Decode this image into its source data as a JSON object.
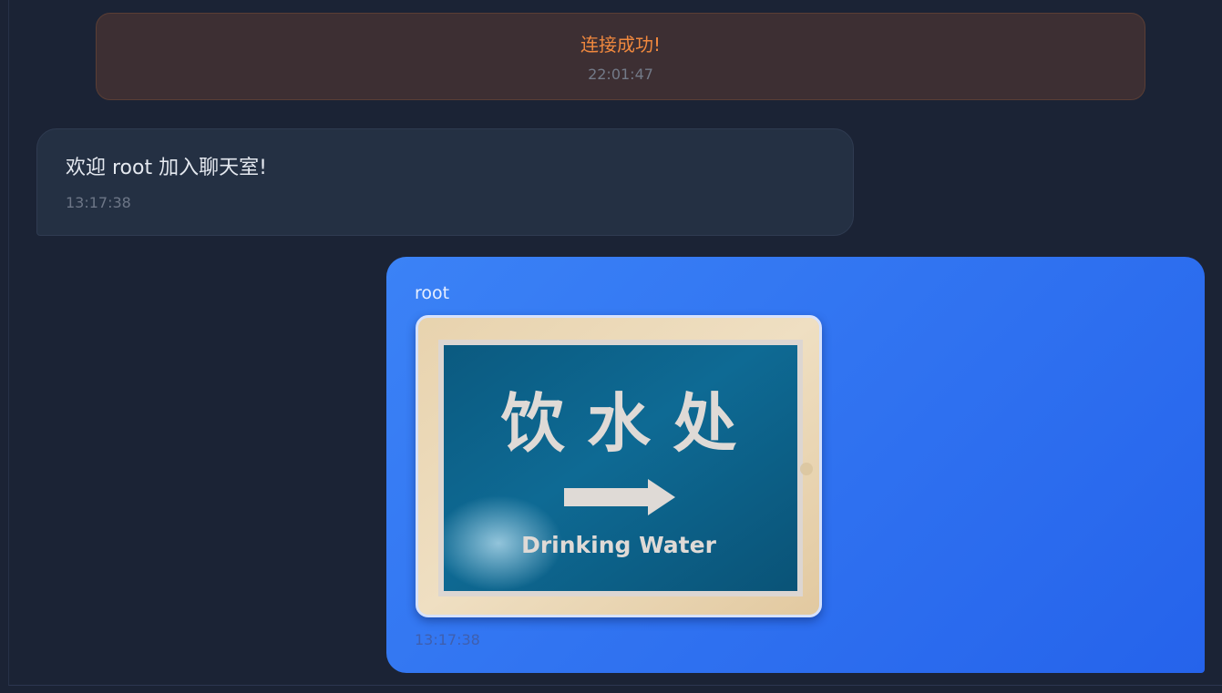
{
  "system_message": {
    "text": "连接成功!",
    "time": "22:01:47"
  },
  "messages": [
    {
      "type": "system-welcome",
      "text": "欢迎 root 加入聊天室!",
      "time": "13:17:38"
    },
    {
      "type": "own-image",
      "sender": "root",
      "image": {
        "sign_title": "饮 水 处",
        "sign_subtitle": "Drinking Water",
        "arrow": "right-arrow-icon"
      },
      "time": "13:17:38"
    }
  ],
  "colors": {
    "background": "#1b2335",
    "system_banner_bg": "#3d2f33",
    "system_text": "#f0883e",
    "own_bubble_start": "#3b82f6",
    "own_bubble_end": "#2563eb",
    "sign_blue": "#0e6189"
  }
}
